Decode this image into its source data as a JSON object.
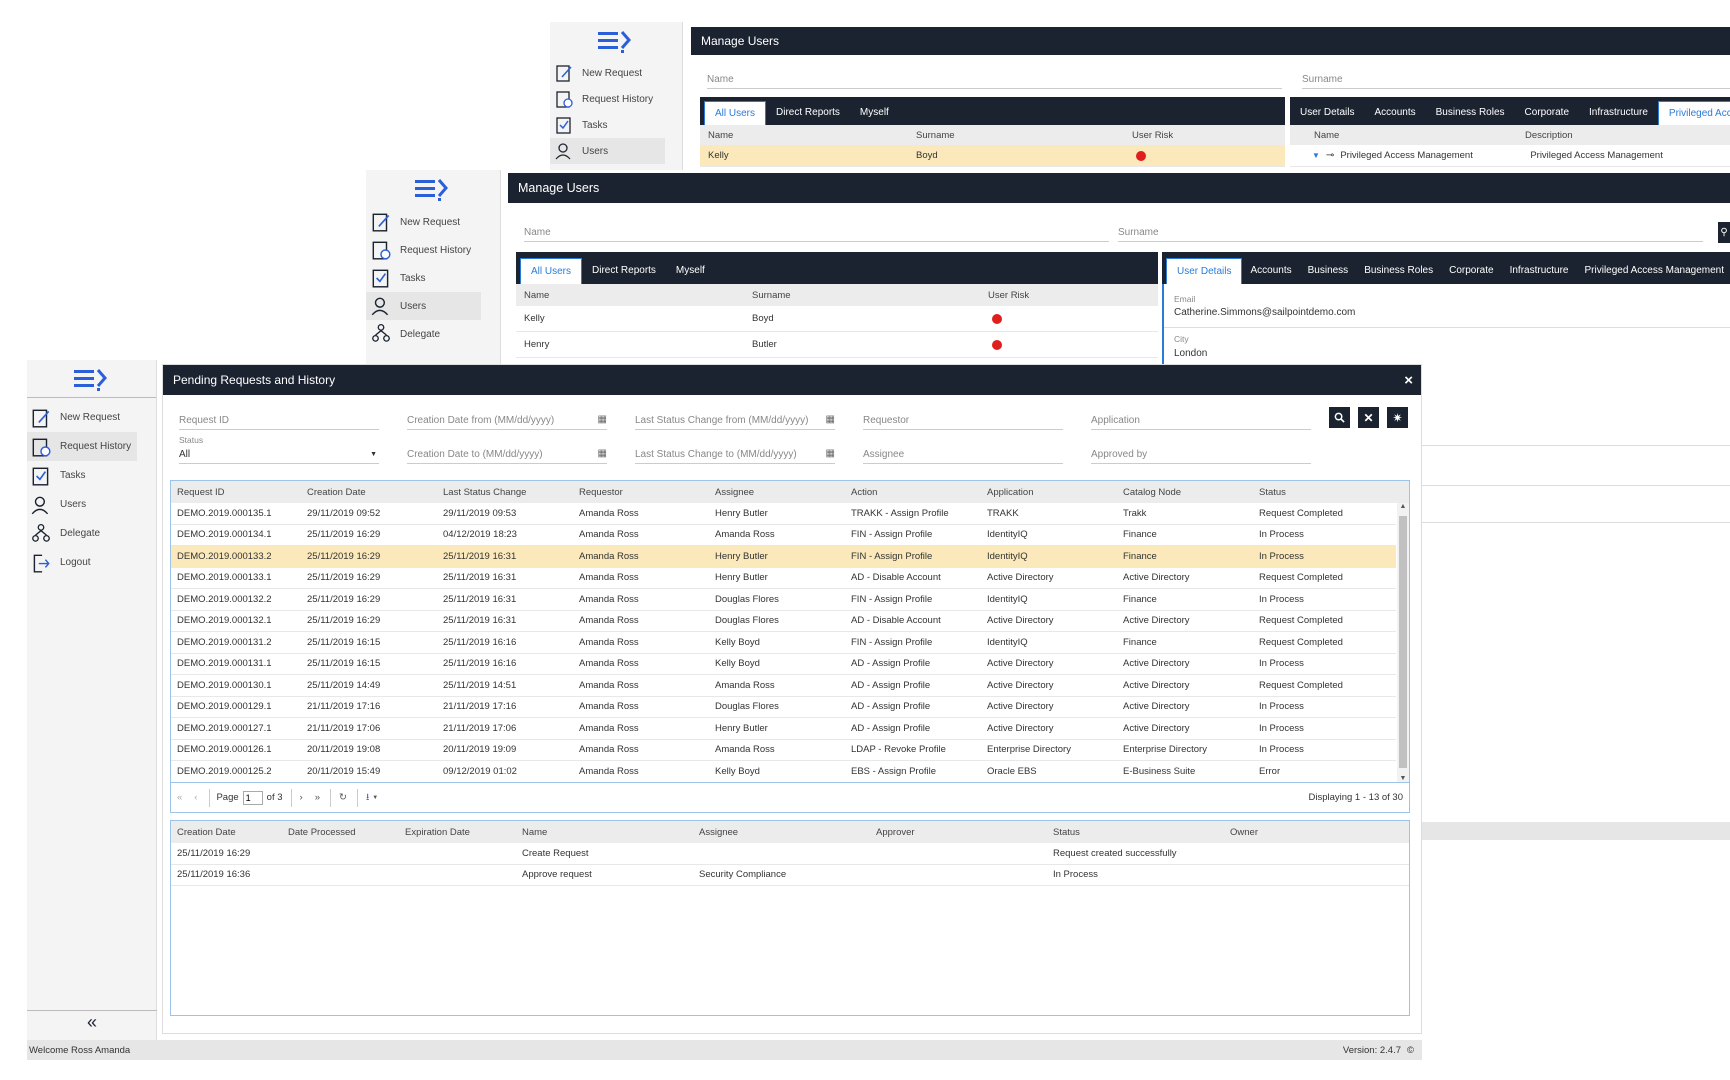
{
  "colors": {
    "header_bg": "#1c2330",
    "accent": "#2b7bd6",
    "highlight": "#fbe9bb",
    "risk": "#e01e1e"
  },
  "back_window": {
    "title": "Manage Users",
    "fields": {
      "name": "Name",
      "surname": "Surname"
    },
    "tabs": [
      "All Users",
      "Direct Reports",
      "Myself"
    ],
    "columns": [
      "Name",
      "Surname",
      "User Risk"
    ],
    "rows": [
      {
        "name": "Kelly",
        "surname": "Boyd"
      }
    ],
    "detail_tabs": [
      "User Details",
      "Accounts",
      "Business Roles",
      "Corporate",
      "Infrastructure",
      "Privileged Acces"
    ],
    "detail_columns": [
      "Name",
      "Description"
    ],
    "detail_row": {
      "name": "Privileged Access Management",
      "description": "Privileged Access Management"
    },
    "nav": [
      "New Request",
      "Request History",
      "Tasks",
      "Users"
    ]
  },
  "mid_window": {
    "title": "Manage Users",
    "fields": {
      "name": "Name",
      "surname": "Surname"
    },
    "tabs": [
      "All Users",
      "Direct Reports",
      "Myself"
    ],
    "columns": [
      "Name",
      "Surname",
      "User Risk"
    ],
    "rows": [
      {
        "name": "Kelly",
        "surname": "Boyd"
      },
      {
        "name": "Henry",
        "surname": "Butler"
      }
    ],
    "detail_tabs": [
      "User Details",
      "Accounts",
      "Business",
      "Business Roles",
      "Corporate",
      "Infrastructure",
      "Privileged Access Management"
    ],
    "email_label": "Email",
    "email": "Catherine.Simmons@sailpointdemo.com",
    "city_label": "City",
    "city": "London",
    "nav": [
      "New Request",
      "Request History",
      "Tasks",
      "Users",
      "Delegate"
    ]
  },
  "front": {
    "nav": [
      "New Request",
      "Request History",
      "Tasks",
      "Users",
      "Delegate",
      "Logout"
    ],
    "collapse": "«",
    "welcome": "Welcome Ross Amanda",
    "version": "Version: 2.4.7",
    "title": "Pending Requests and History",
    "close": "×",
    "filters": {
      "request_id": "Request ID",
      "creation_from": "Creation Date from (MM/dd/yyyy)",
      "status_change_from": "Last Status Change from (MM/dd/yyyy)",
      "requestor": "Requestor",
      "application": "Application",
      "status_label": "Status",
      "status_value": "All",
      "creation_to": "Creation Date to (MM/dd/yyyy)",
      "status_change_to": "Last Status Change to (MM/dd/yyyy)",
      "assignee": "Assignee",
      "approved_by": "Approved by"
    },
    "columns": [
      "Request ID",
      "Creation Date",
      "Last Status Change",
      "Requestor",
      "Assignee",
      "Action",
      "Application",
      "Catalog Node",
      "Status"
    ],
    "rows": [
      [
        "DEMO.2019.000135.1",
        "29/11/2019 09:52",
        "29/11/2019 09:53",
        "Amanda Ross",
        "Henry Butler",
        "TRAKK - Assign Profile",
        "TRAKK",
        "Trakk",
        "Request Completed"
      ],
      [
        "DEMO.2019.000134.1",
        "25/11/2019 16:29",
        "04/12/2019 18:23",
        "Amanda Ross",
        "Amanda Ross",
        "FIN - Assign Profile",
        "IdentityIQ",
        "Finance",
        "In Process"
      ],
      [
        "DEMO.2019.000133.2",
        "25/11/2019 16:29",
        "25/11/2019 16:31",
        "Amanda Ross",
        "Henry Butler",
        "FIN - Assign Profile",
        "IdentityIQ",
        "Finance",
        "In Process"
      ],
      [
        "DEMO.2019.000133.1",
        "25/11/2019 16:29",
        "25/11/2019 16:31",
        "Amanda Ross",
        "Henry Butler",
        "AD - Disable Account",
        "Active Directory",
        "Active Directory",
        "Request Completed"
      ],
      [
        "DEMO.2019.000132.2",
        "25/11/2019 16:29",
        "25/11/2019 16:31",
        "Amanda Ross",
        "Douglas Flores",
        "FIN - Assign Profile",
        "IdentityIQ",
        "Finance",
        "In Process"
      ],
      [
        "DEMO.2019.000132.1",
        "25/11/2019 16:29",
        "25/11/2019 16:31",
        "Amanda Ross",
        "Douglas Flores",
        "AD - Disable Account",
        "Active Directory",
        "Active Directory",
        "Request Completed"
      ],
      [
        "DEMO.2019.000131.2",
        "25/11/2019 16:15",
        "25/11/2019 16:16",
        "Amanda Ross",
        "Kelly Boyd",
        "FIN - Assign Profile",
        "IdentityIQ",
        "Finance",
        "Request Completed"
      ],
      [
        "DEMO.2019.000131.1",
        "25/11/2019 16:15",
        "25/11/2019 16:16",
        "Amanda Ross",
        "Kelly Boyd",
        "AD - Assign Profile",
        "Active Directory",
        "Active Directory",
        "In Process"
      ],
      [
        "DEMO.2019.000130.1",
        "25/11/2019 14:49",
        "25/11/2019 14:51",
        "Amanda Ross",
        "Amanda Ross",
        "AD - Assign Profile",
        "Active Directory",
        "Active Directory",
        "Request Completed"
      ],
      [
        "DEMO.2019.000129.1",
        "21/11/2019 17:16",
        "21/11/2019 17:16",
        "Amanda Ross",
        "Douglas Flores",
        "AD - Assign Profile",
        "Active Directory",
        "Active Directory",
        "In Process"
      ],
      [
        "DEMO.2019.000127.1",
        "21/11/2019 17:06",
        "21/11/2019 17:06",
        "Amanda Ross",
        "Henry Butler",
        "AD - Assign Profile",
        "Active Directory",
        "Active Directory",
        "In Process"
      ],
      [
        "DEMO.2019.000126.1",
        "20/11/2019 19:08",
        "20/11/2019 19:09",
        "Amanda Ross",
        "Amanda Ross",
        "LDAP - Revoke Profile",
        "Enterprise Directory",
        "Enterprise Directory",
        "In Process"
      ],
      [
        "DEMO.2019.000125.2",
        "20/11/2019 15:49",
        "09/12/2019 01:02",
        "Amanda Ross",
        "Kelly Boyd",
        "EBS - Assign Profile",
        "Oracle EBS",
        "E-Business Suite",
        "Error"
      ]
    ],
    "selected_row": 2,
    "pager": {
      "page_label": "Page",
      "page": "1",
      "of": "of 3",
      "displaying": "Displaying 1 - 13 of 30"
    },
    "history_columns": [
      "Creation Date",
      "Date Processed",
      "Expiration Date",
      "Name",
      "Assignee",
      "Approver",
      "Status",
      "Owner"
    ],
    "history_rows": [
      [
        "25/11/2019 16:29",
        "",
        "",
        "Create Request",
        "",
        "",
        "Request created successfully",
        ""
      ],
      [
        "25/11/2019 16:36",
        "",
        "",
        "Approve request",
        "Security Compliance",
        "",
        "In Process",
        ""
      ]
    ]
  }
}
